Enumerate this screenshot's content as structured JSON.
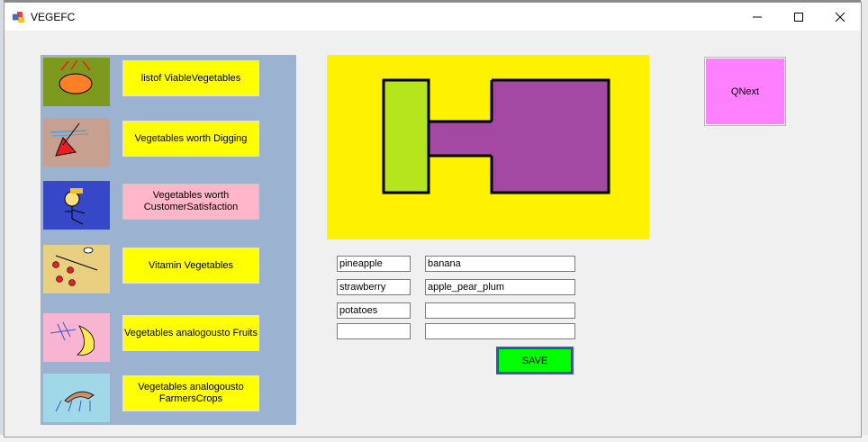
{
  "window": {
    "title": "VEGEFC"
  },
  "menu": [
    {
      "label": "listof ViableVegetables",
      "style": "yellow",
      "thumb": "orange-ellipse-icon",
      "thumb_bg": "#7d9a1f"
    },
    {
      "label": "Vegetables worth Digging",
      "style": "yellow",
      "thumb": "red-triangle-icon",
      "thumb_bg": "#c8a090"
    },
    {
      "label": "Vegetables worth CustomerSatisfaction",
      "style": "pink",
      "thumb": "stick-figure-icon",
      "thumb_bg": "#3648c8"
    },
    {
      "label": "Vitamin Vegetables",
      "style": "yellow",
      "thumb": "red-dots-icon",
      "thumb_bg": "#e8d080"
    },
    {
      "label": "Vegetables analogousto Fruits",
      "style": "yellow",
      "thumb": "banana-icon",
      "thumb_bg": "#f8b4d0"
    },
    {
      "label": "Vegetables analogousto FarmersCrops",
      "style": "yellow",
      "thumb": "crops-icon",
      "thumb_bg": "#a0d8e8"
    }
  ],
  "qnext_label": "QNext",
  "fields": {
    "left": [
      "pineapple",
      "strawberry",
      "potatoes",
      ""
    ],
    "right": [
      "banana",
      "apple_pear_plum",
      "",
      ""
    ]
  },
  "save_label": "SAVE",
  "colors": {
    "preview_bg": "#fff200",
    "green_block": "#b5e61d",
    "purple_block": "#a349a4",
    "qnext_bg": "#ff80ff",
    "save_bg": "#00ff00",
    "panel_bg": "#9bb3d1"
  }
}
